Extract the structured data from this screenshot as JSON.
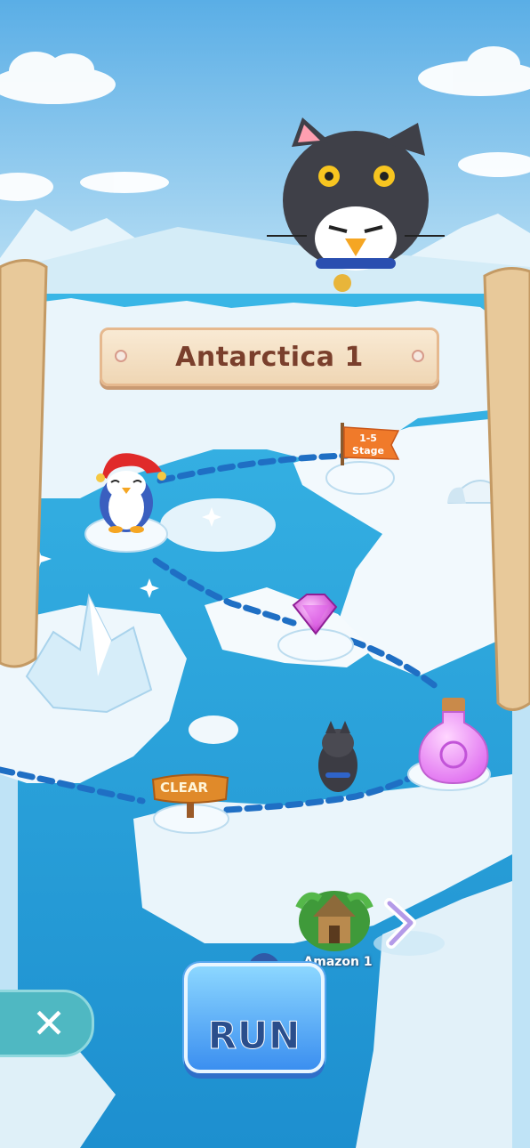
{
  "level": {
    "title": "Antarctica 1",
    "stage_flag_line1": "1-5",
    "stage_flag_line2": "Stage",
    "clear_sign": "CLEAR",
    "next_world_label": "Amazon 1"
  },
  "controls": {
    "run_label": "RUN",
    "close_icon": "close-icon"
  },
  "colors": {
    "water": "#2aa3d8",
    "ice": "#eaf5fb",
    "path_dash": "#1f6fc4",
    "title_text": "#7a3f2c",
    "run_button": "#3b8ff0",
    "close_button": "#4fb8c2"
  }
}
